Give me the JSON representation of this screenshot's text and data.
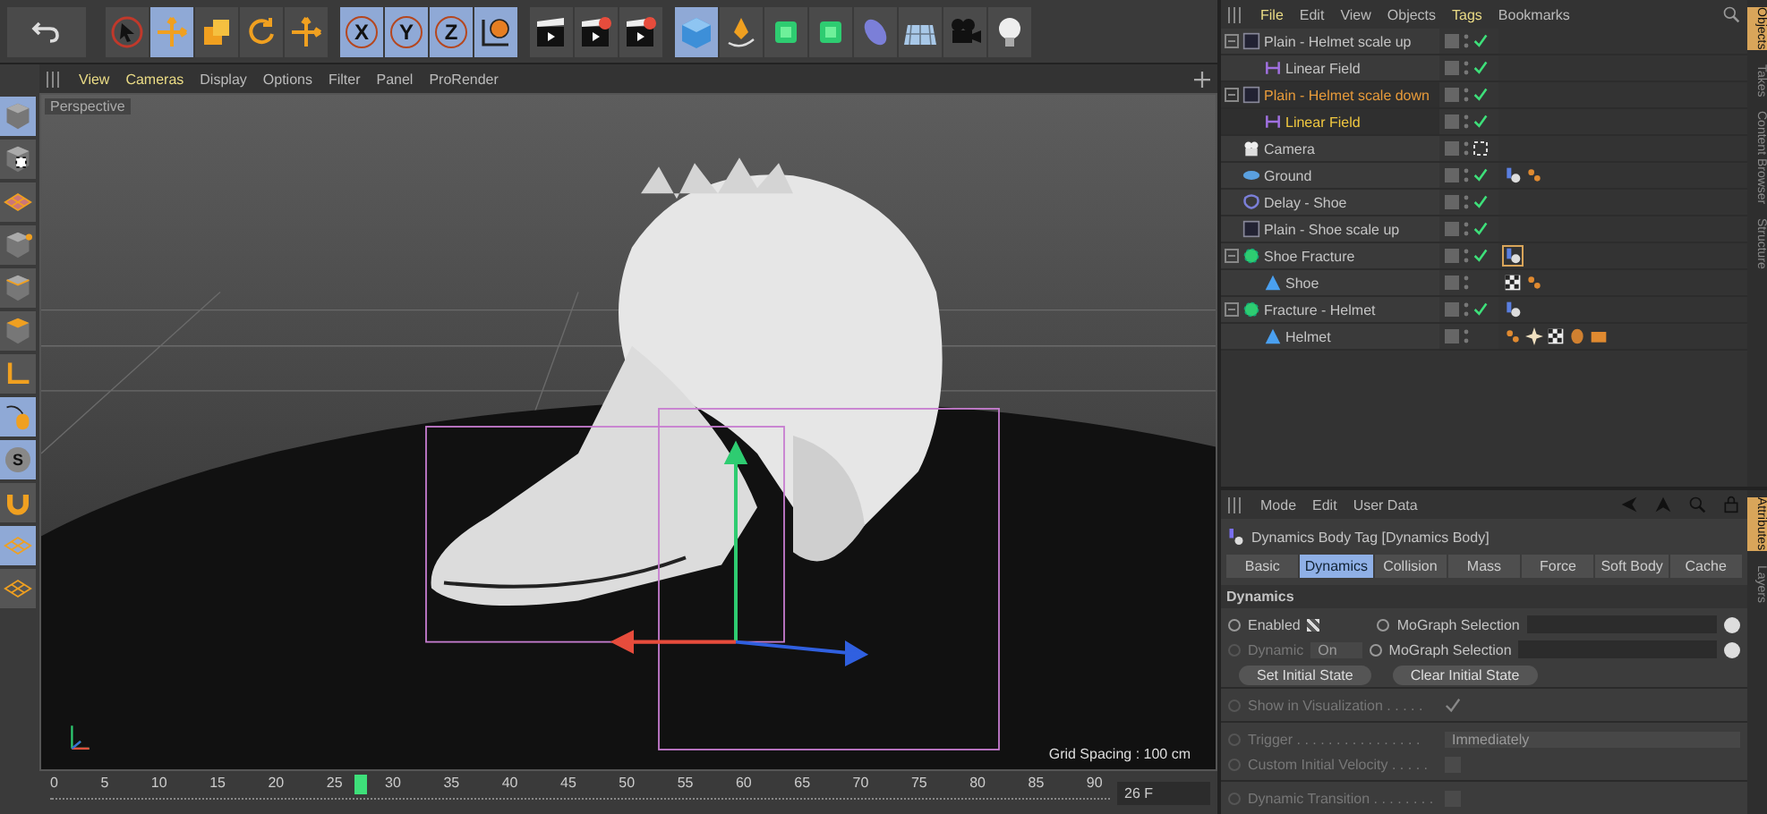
{
  "toolbar": {
    "tools": [
      {
        "kind": "undo",
        "selected": false
      },
      {
        "kind": "select",
        "selected": false
      },
      {
        "kind": "move",
        "selected": true
      },
      {
        "kind": "scale",
        "selected": false
      },
      {
        "kind": "rotate",
        "selected": false
      },
      {
        "kind": "add",
        "selected": false
      },
      {
        "kind": "axis",
        "label": "X",
        "selected": true
      },
      {
        "kind": "axis",
        "label": "Y",
        "selected": true
      },
      {
        "kind": "axis",
        "label": "Z",
        "selected": true
      },
      {
        "kind": "world",
        "selected": true
      },
      {
        "kind": "render-view",
        "selected": false
      },
      {
        "kind": "render",
        "selected": false
      },
      {
        "kind": "render-settings",
        "selected": false
      },
      {
        "kind": "cube",
        "selected": true
      },
      {
        "kind": "pen",
        "selected": false
      },
      {
        "kind": "cloner",
        "selected": false
      },
      {
        "kind": "array",
        "selected": false
      },
      {
        "kind": "deformer",
        "selected": false
      },
      {
        "kind": "floor",
        "selected": false
      },
      {
        "kind": "camera",
        "selected": false
      },
      {
        "kind": "light",
        "selected": false
      }
    ]
  },
  "left_toolbar": {
    "tools": [
      {
        "kind": "model",
        "selected": true
      },
      {
        "kind": "texture",
        "selected": false
      },
      {
        "kind": "workplane",
        "selected": false
      },
      {
        "kind": "points",
        "selected": false
      },
      {
        "kind": "edges",
        "selected": false
      },
      {
        "kind": "polygons",
        "selected": false
      },
      {
        "kind": "axis-mode",
        "selected": false
      },
      {
        "kind": "tweak",
        "selected": true
      },
      {
        "kind": "solo",
        "label": "S",
        "selected": true
      },
      {
        "kind": "snap",
        "selected": false
      },
      {
        "kind": "grid-lock",
        "selected": true
      },
      {
        "kind": "grid-sync",
        "selected": false
      }
    ]
  },
  "viewport": {
    "menu": [
      {
        "label": "View",
        "highlighted": true
      },
      {
        "label": "Cameras",
        "highlighted": true
      },
      {
        "label": "Display",
        "highlighted": false
      },
      {
        "label": "Options",
        "highlighted": false
      },
      {
        "label": "Filter",
        "highlighted": false
      },
      {
        "label": "Panel",
        "highlighted": false
      },
      {
        "label": "ProRender",
        "highlighted": false
      }
    ],
    "camera_label": "Perspective",
    "grid_spacing": "Grid Spacing : 100 cm"
  },
  "timeline": {
    "ticks": [
      "0",
      "5",
      "10",
      "15",
      "20",
      "25",
      "30",
      "35",
      "40",
      "45",
      "50",
      "55",
      "60",
      "65",
      "70",
      "75",
      "80",
      "85",
      "90"
    ],
    "level": 0.289,
    "frame": "26 F"
  },
  "object_manager": {
    "menu": [
      {
        "label": "File",
        "highlighted": true
      },
      {
        "label": "Edit",
        "highlighted": false
      },
      {
        "label": "View",
        "highlighted": false
      },
      {
        "label": "Objects",
        "highlighted": false
      },
      {
        "label": "Tags",
        "highlighted": true
      },
      {
        "label": "Bookmarks",
        "highlighted": false
      }
    ],
    "side_tabs": [
      {
        "label": "Objects",
        "selected": true
      },
      {
        "label": "Takes",
        "selected": false
      },
      {
        "label": "Content Browser",
        "selected": false
      },
      {
        "label": "Structure",
        "selected": false
      }
    ],
    "objects": [
      {
        "name": "Plain - Helmet scale up",
        "kind": "plain",
        "selected": false,
        "enabled": true,
        "children": [
          {
            "name": "Linear Field",
            "kind": "field",
            "selected": false,
            "enabled": true
          }
        ]
      },
      {
        "name": "Plain - Helmet scale down",
        "kind": "plain",
        "selected": true,
        "enabled": true,
        "children": [
          {
            "name": "Linear Field",
            "kind": "field",
            "selected": true,
            "enabled": true
          }
        ]
      },
      {
        "name": "Camera",
        "kind": "camera",
        "selected": false
      },
      {
        "name": "Ground",
        "kind": "ground",
        "selected": false,
        "enabled": true,
        "tags": [
          {
            "kind": "dynamics"
          },
          {
            "kind": "selection"
          }
        ]
      },
      {
        "name": "Delay - Shoe",
        "kind": "delay",
        "selected": false,
        "enabled": true
      },
      {
        "name": "Plain - Shoe scale up",
        "kind": "plain",
        "selected": false,
        "enabled": true
      },
      {
        "name": "Shoe Fracture",
        "kind": "fracture",
        "selected": false,
        "enabled": true,
        "tags": [
          {
            "kind": "dynamics-active"
          }
        ],
        "children": [
          {
            "name": "Shoe",
            "kind": "mesh",
            "selected": false,
            "tags": [
              {
                "kind": "checker"
              },
              {
                "kind": "selection"
              }
            ]
          }
        ]
      },
      {
        "name": "Fracture - Helmet",
        "kind": "fracture",
        "selected": false,
        "enabled": true,
        "tags": [
          {
            "kind": "dynamics"
          }
        ],
        "children": [
          {
            "name": "Helmet",
            "kind": "mesh",
            "selected": false,
            "tags": [
              {
                "kind": "selection"
              },
              {
                "kind": "star"
              },
              {
                "kind": "checker"
              },
              {
                "kind": "bug"
              },
              {
                "kind": "box"
              }
            ]
          }
        ]
      }
    ]
  },
  "attributes": {
    "menu": [
      {
        "label": "Mode",
        "highlighted": false
      },
      {
        "label": "Edit",
        "highlighted": false
      },
      {
        "label": "User Data",
        "highlighted": false
      }
    ],
    "side_tabs": [
      {
        "label": "Attributes",
        "selected": true
      },
      {
        "label": "Layers",
        "selected": false
      }
    ],
    "title": "Dynamics Body Tag [Dynamics Body]",
    "tabs": [
      {
        "label": "Basic",
        "selected": false
      },
      {
        "label": "Dynamics",
        "selected": true
      },
      {
        "label": "Collision",
        "selected": false
      },
      {
        "label": "Mass",
        "selected": false
      },
      {
        "label": "Force",
        "selected": false
      },
      {
        "label": "Soft Body",
        "selected": false
      },
      {
        "label": "Cache",
        "selected": false
      }
    ],
    "group": "Dynamics",
    "enabled": {
      "label": "Enabled",
      "checked": true
    },
    "dynamic": {
      "label": "Dynamic",
      "value": "On",
      "disabled": true
    },
    "selections": [
      {
        "label": "MoGraph Selection"
      },
      {
        "label": "MoGraph Selection"
      }
    ],
    "buttons": [
      "Set Initial State",
      "Clear Initial State"
    ],
    "settings": [
      [
        {
          "kind": "check",
          "label": "Show in Visualization . . . . .",
          "checked": true,
          "disabled": true
        }
      ],
      [
        {
          "kind": "dropdown",
          "label": "Trigger . . . . . . . . . . . . . . . .",
          "value": "Immediately",
          "disabled": true
        },
        {
          "kind": "check",
          "label": "Custom Initial Velocity . . . . .",
          "checked": false,
          "disabled": true
        }
      ],
      [
        {
          "kind": "check",
          "label": "Dynamic Transition . . . . . . . .",
          "checked": false,
          "disabled": true
        }
      ]
    ]
  }
}
